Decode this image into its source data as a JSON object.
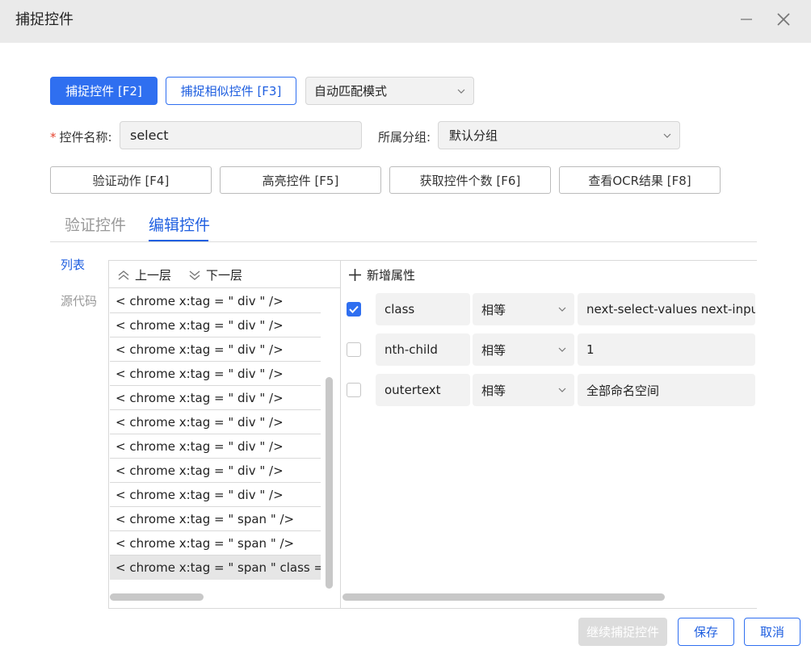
{
  "window": {
    "title": "捕捉控件"
  },
  "toolbar": {
    "capture_label": "捕捉控件 [F2]",
    "capture_similar_label": "捕捉相似控件 [F3]",
    "match_mode_value": "自动匹配模式"
  },
  "form": {
    "name_label": "控件名称:",
    "name_value": "select",
    "group_label": "所属分组:",
    "group_value": "默认分组"
  },
  "actions": {
    "verify_action": "验证动作 [F4]",
    "highlight": "高亮控件 [F5]",
    "get_count": "获取控件个数 [F6]",
    "view_ocr": "查看OCR结果 [F8]"
  },
  "tabs": [
    {
      "label": "验证控件",
      "active": false
    },
    {
      "label": "编辑控件",
      "active": true
    }
  ],
  "side_nav": [
    {
      "label": "列表",
      "active": true
    },
    {
      "label": "源代码",
      "active": false
    }
  ],
  "tree": {
    "up_label": "上一层",
    "down_label": "下一层",
    "rows": [
      "< chrome  x:tag = \" div \" />",
      "< chrome  x:tag = \" div \" />",
      "< chrome  x:tag = \" div \" />",
      "< chrome  x:tag = \" div \" />",
      "< chrome  x:tag = \" div \" />",
      "< chrome  x:tag = \" div \" />",
      "< chrome  x:tag = \" div \" />",
      "< chrome  x:tag = \" div \" />",
      "< chrome  x:tag = \" div \" />",
      "< chrome  x:tag = \" span \" />",
      "< chrome  x:tag = \" span \" />",
      "< chrome  x:tag = \" span \"  class = \""
    ],
    "selected_index": 11
  },
  "attributes": {
    "add_label": "新增属性",
    "rows": [
      {
        "checked": true,
        "name": "class",
        "op": "相等",
        "value": "next-select-values next-input"
      },
      {
        "checked": false,
        "name": "nth-child",
        "op": "相等",
        "value": "1"
      },
      {
        "checked": false,
        "name": "outertext",
        "op": "相等",
        "value": "全部命名空间"
      }
    ]
  },
  "footer": {
    "continue_label": "继续捕捉控件",
    "save_label": "保存",
    "cancel_label": "取消"
  },
  "colors": {
    "primary": "#2f6ff0",
    "required_mark": "#e5432f",
    "titlebar_bg": "#eaeaea"
  }
}
